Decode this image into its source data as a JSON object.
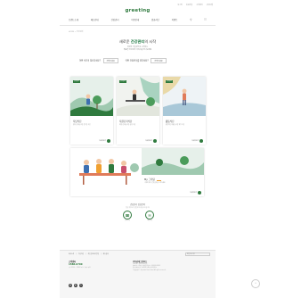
{
  "header": {
    "util_links": [
      "로그인",
      "회원가입",
      "고객센터",
      "사이트맵"
    ],
    "brand": "greeting",
    "nav": [
      "브랜드소개",
      "메뉴안내",
      "건강관리",
      "이용안내",
      "맞춤식단",
      "이벤트"
    ],
    "breadcrumb": "HOME > 건강관리"
  },
  "hero": {
    "title_pre": "새로운",
    "title_em": "건강관리",
    "title_post": "의 시작",
    "desc_line1": "건강한 식습관으로 시작하는",
    "desc_line2": "맞춤형 건강관리 서비스를 만나보세요"
  },
  "query": {
    "q1_label": "어떤 식단이 필요하세요?",
    "q1_value": "선택하세요",
    "q2_label": "어떤 건강관리를 원하세요?",
    "q2_value": "선택하세요"
  },
  "cards": [
    {
      "tag": "건강관리",
      "title": "저당식단",
      "desc": "혈당 관리를 위한 건강한 식단",
      "more": "자세히보기"
    },
    {
      "tag": "건강관리",
      "title": "저칼로리식단",
      "desc": "체중 관리를 위한 균형 식단",
      "more": "자세히보기"
    },
    {
      "tag": "건강관리",
      "title": "활동식단",
      "desc": "활동적인 생활을 위한 영양 식단",
      "more": "자세히보기"
    }
  ],
  "wide_cards": [
    {
      "title": "",
      "desc": ""
    },
    {
      "title": "My 그리팅",
      "badge": "NEW",
      "desc": "나에게 맞는 건강관리를 시작하세요",
      "more": "자세히보기"
    }
  ],
  "contact": {
    "title": "건강관리 상담문의",
    "desc": "전문 영양사가 친절하게 상담해 드립니다",
    "items": [
      {
        "icon": "phone-icon",
        "label": "전화상담"
      },
      {
        "icon": "chat-icon",
        "label": "채팅상담"
      }
    ]
  },
  "footer": {
    "links": [
      "회사소개",
      "이용약관",
      "개인정보처리방침",
      "제휴문의"
    ],
    "family_site": "패밀리사이트",
    "cs_title": "고객센터",
    "cs_phone": "1588-0700",
    "cs_hours": "평일 09:00 ~ 18:00 (주말, 공휴일 휴무)",
    "company_title": "(주)현대그린푸드",
    "company_lines": [
      "서울특별시 강남구 테헤란로",
      "대표이사 : 박홍진  사업자등록번호 : 000-00-00000",
      "통신판매업신고 : 제0000-서울강남-00000호",
      "Copyright © Hyundai Green Food. All rights reserved."
    ],
    "sns": [
      "instagram-icon",
      "youtube-icon",
      "blog-icon"
    ]
  },
  "colors": {
    "brand": "#2f7a3e",
    "accent": "#f0a030"
  }
}
